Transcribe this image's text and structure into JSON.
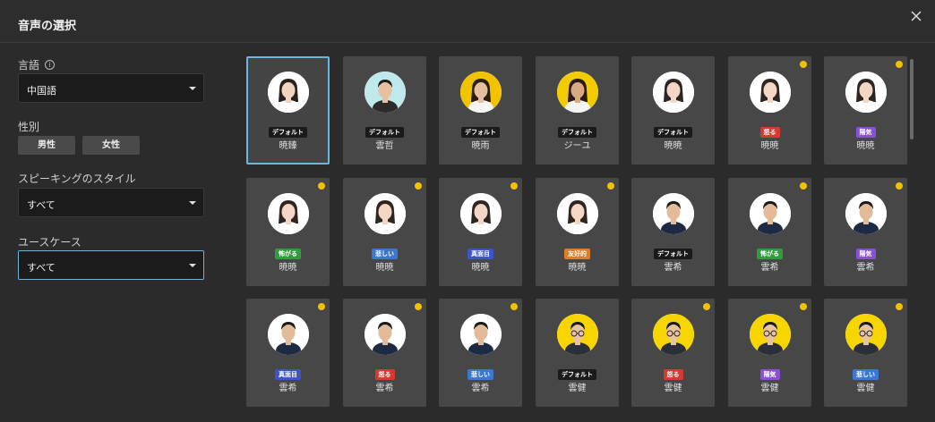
{
  "dialog": {
    "title": "音声の選択"
  },
  "filters": {
    "language_label": "言語",
    "language_value": "中国語",
    "gender_label": "性別",
    "gender_options": [
      "男性",
      "女性"
    ],
    "style_label": "スピーキングのスタイル",
    "style_value": "すべて",
    "usecase_label": "ユースケース",
    "usecase_value": "すべて"
  },
  "voices": [
    {
      "name": "暁臻",
      "tag": "デフォルト",
      "tag_color": "#1a1a1a",
      "avatar": "female-a",
      "premium": false
    },
    {
      "name": "雲哲",
      "tag": "デフォルト",
      "tag_color": "#1a1a1a",
      "avatar": "male-a",
      "premium": false
    },
    {
      "name": "暁雨",
      "tag": "デフォルト",
      "tag_color": "#1a1a1a",
      "avatar": "female-b",
      "premium": false
    },
    {
      "name": "ジーユ",
      "tag": "デフォルト",
      "tag_color": "#1a1a1a",
      "avatar": "female-c",
      "premium": false
    },
    {
      "name": "暁暁",
      "tag": "デフォルト",
      "tag_color": "#1a1a1a",
      "avatar": "female-d",
      "premium": false
    },
    {
      "name": "暁暁",
      "tag": "怒る",
      "tag_color": "#d43a2f",
      "avatar": "female-d",
      "premium": true
    },
    {
      "name": "暁暁",
      "tag": "陽気",
      "tag_color": "#8a4fd6",
      "avatar": "female-d",
      "premium": true
    },
    {
      "name": "暁暁",
      "tag": "怖がる",
      "tag_color": "#2e9e3c",
      "avatar": "female-d",
      "premium": true
    },
    {
      "name": "暁暁",
      "tag": "悲しい",
      "tag_color": "#3a78d4",
      "avatar": "female-d",
      "premium": true
    },
    {
      "name": "暁暁",
      "tag": "真面目",
      "tag_color": "#3d54c8",
      "avatar": "female-d",
      "premium": true
    },
    {
      "name": "暁暁",
      "tag": "友好的",
      "tag_color": "#e07b26",
      "avatar": "female-d",
      "premium": true
    },
    {
      "name": "雲希",
      "tag": "デフォルト",
      "tag_color": "#1a1a1a",
      "avatar": "male-b",
      "premium": false
    },
    {
      "name": "雲希",
      "tag": "怖がる",
      "tag_color": "#2e9e3c",
      "avatar": "male-b",
      "premium": true
    },
    {
      "name": "雲希",
      "tag": "陽気",
      "tag_color": "#8a4fd6",
      "avatar": "male-b",
      "premium": true
    },
    {
      "name": "雲希",
      "tag": "真面目",
      "tag_color": "#3d54c8",
      "avatar": "male-b",
      "premium": true
    },
    {
      "name": "雲希",
      "tag": "怒る",
      "tag_color": "#d43a2f",
      "avatar": "male-b",
      "premium": true
    },
    {
      "name": "雲希",
      "tag": "悲しい",
      "tag_color": "#3a78d4",
      "avatar": "male-b",
      "premium": true
    },
    {
      "name": "雲健",
      "tag": "デフォルト",
      "tag_color": "#1a1a1a",
      "avatar": "male-c",
      "premium": false
    },
    {
      "name": "雲健",
      "tag": "怒る",
      "tag_color": "#d43a2f",
      "avatar": "male-c",
      "premium": true
    },
    {
      "name": "雲健",
      "tag": "陽気",
      "tag_color": "#8a4fd6",
      "avatar": "male-c",
      "premium": true
    },
    {
      "name": "雲健",
      "tag": "悲しい",
      "tag_color": "#3a78d4",
      "avatar": "male-c",
      "premium": true
    }
  ],
  "selected_index": 0
}
